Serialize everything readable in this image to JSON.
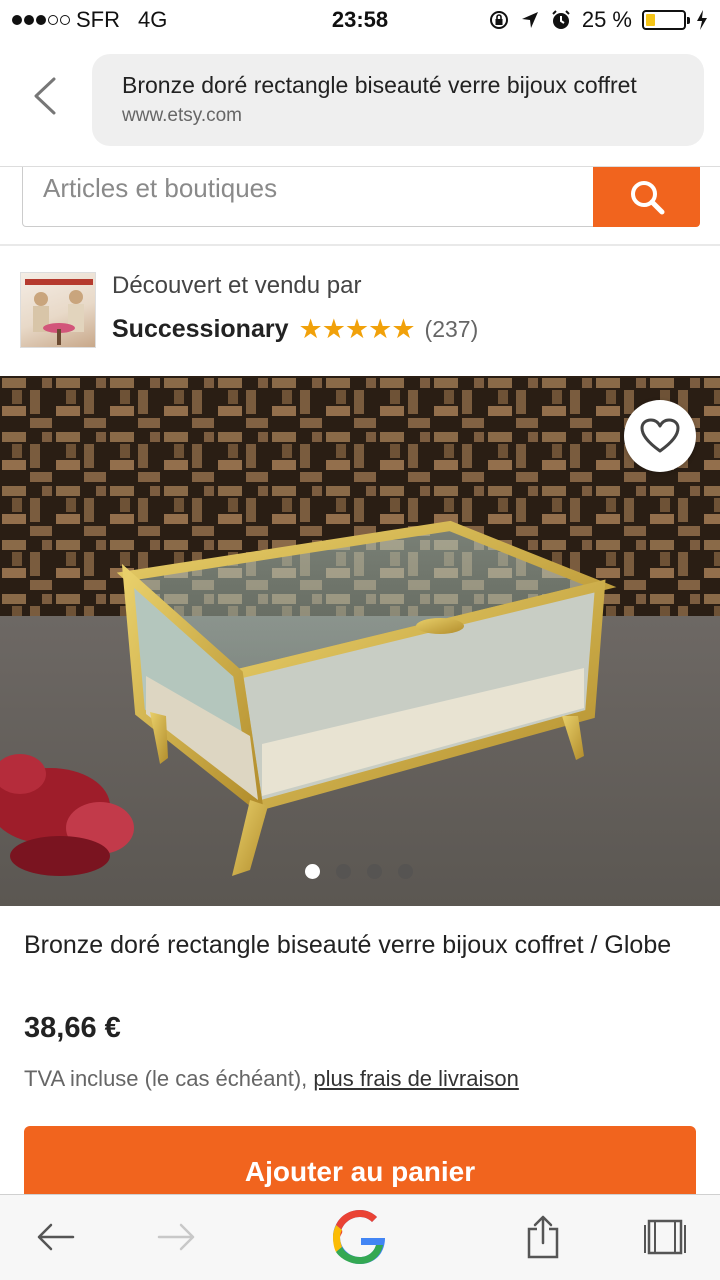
{
  "status_bar": {
    "carrier": "SFR",
    "network": "4G",
    "time": "23:58",
    "battery_percent": "25 %",
    "battery_level": 0.25,
    "signal_bars_filled": 3,
    "signal_bars_total": 5
  },
  "browser": {
    "page_title": "Bronze doré rectangle biseauté verre bijoux coffret",
    "host": "www.etsy.com"
  },
  "search": {
    "placeholder": "Articles et boutiques"
  },
  "shop": {
    "caption": "Découvert et vendu par",
    "name": "Successionary",
    "stars": "★★★★★",
    "rating": 5,
    "review_count": "(237)"
  },
  "product": {
    "title": "Bronze doré rectangle biseauté verre bijoux coffret / Globe",
    "price": "38,66 €",
    "tax_note": "TVA incluse (le cas échéant),",
    "shipping_link": "plus frais de livraison",
    "image_count": 4,
    "active_image_index": 0,
    "add_to_cart": "Ajouter au panier"
  },
  "toolbar": {
    "icons": [
      "back-arrow-icon",
      "forward-arrow-icon",
      "google-logo",
      "share-icon",
      "tabs-icon"
    ]
  },
  "colors": {
    "accent": "#f1641e",
    "star": "#f1a10a",
    "battery": "#f5c518"
  }
}
